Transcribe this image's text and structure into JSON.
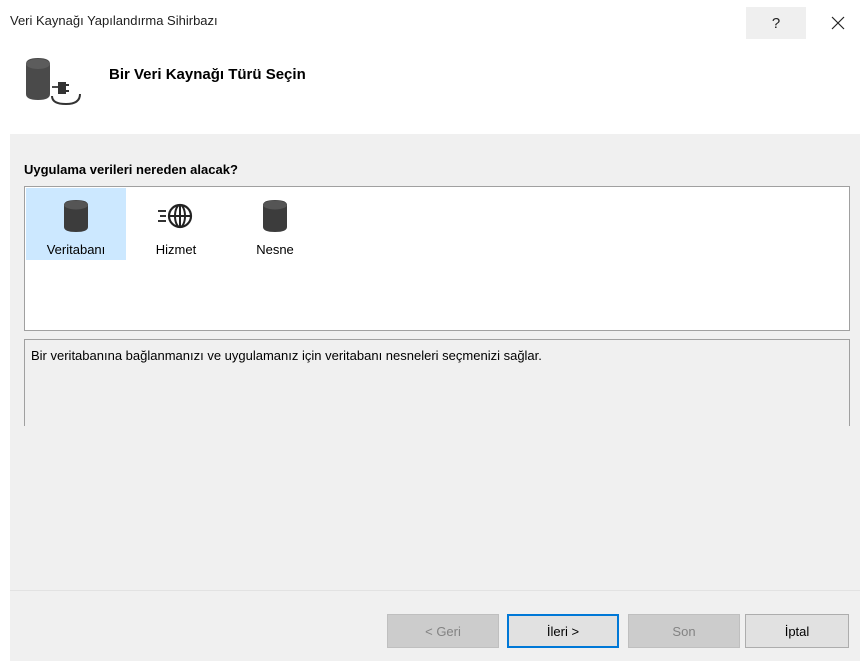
{
  "window": {
    "title": "Veri Kaynağı Yapılandırma Sihirbazı",
    "help_label": "?",
    "close_icon": "close-icon"
  },
  "header": {
    "title": "Bir Veri Kaynağı Türü Seçin",
    "icon": "database-plug-icon"
  },
  "main": {
    "question": "Uygulama verileri nereden alacak?",
    "types": [
      {
        "label": "Veritabanı",
        "icon": "database-icon",
        "selected": true
      },
      {
        "label": "Hizmet",
        "icon": "service-globe-icon",
        "selected": false
      },
      {
        "label": "Nesne",
        "icon": "object-icon",
        "selected": false
      }
    ],
    "description": "Bir veritabanına bağlanmanızı ve uygulamanız için veritabanı nesneleri seçmenizi sağlar."
  },
  "footer": {
    "back_label": "< Geri",
    "next_label": "İleri >",
    "finish_label": "Son",
    "cancel_label": "İptal"
  },
  "colors": {
    "accent": "#0078d7",
    "selection": "#cce8ff",
    "panel": "#f0f0f0"
  }
}
